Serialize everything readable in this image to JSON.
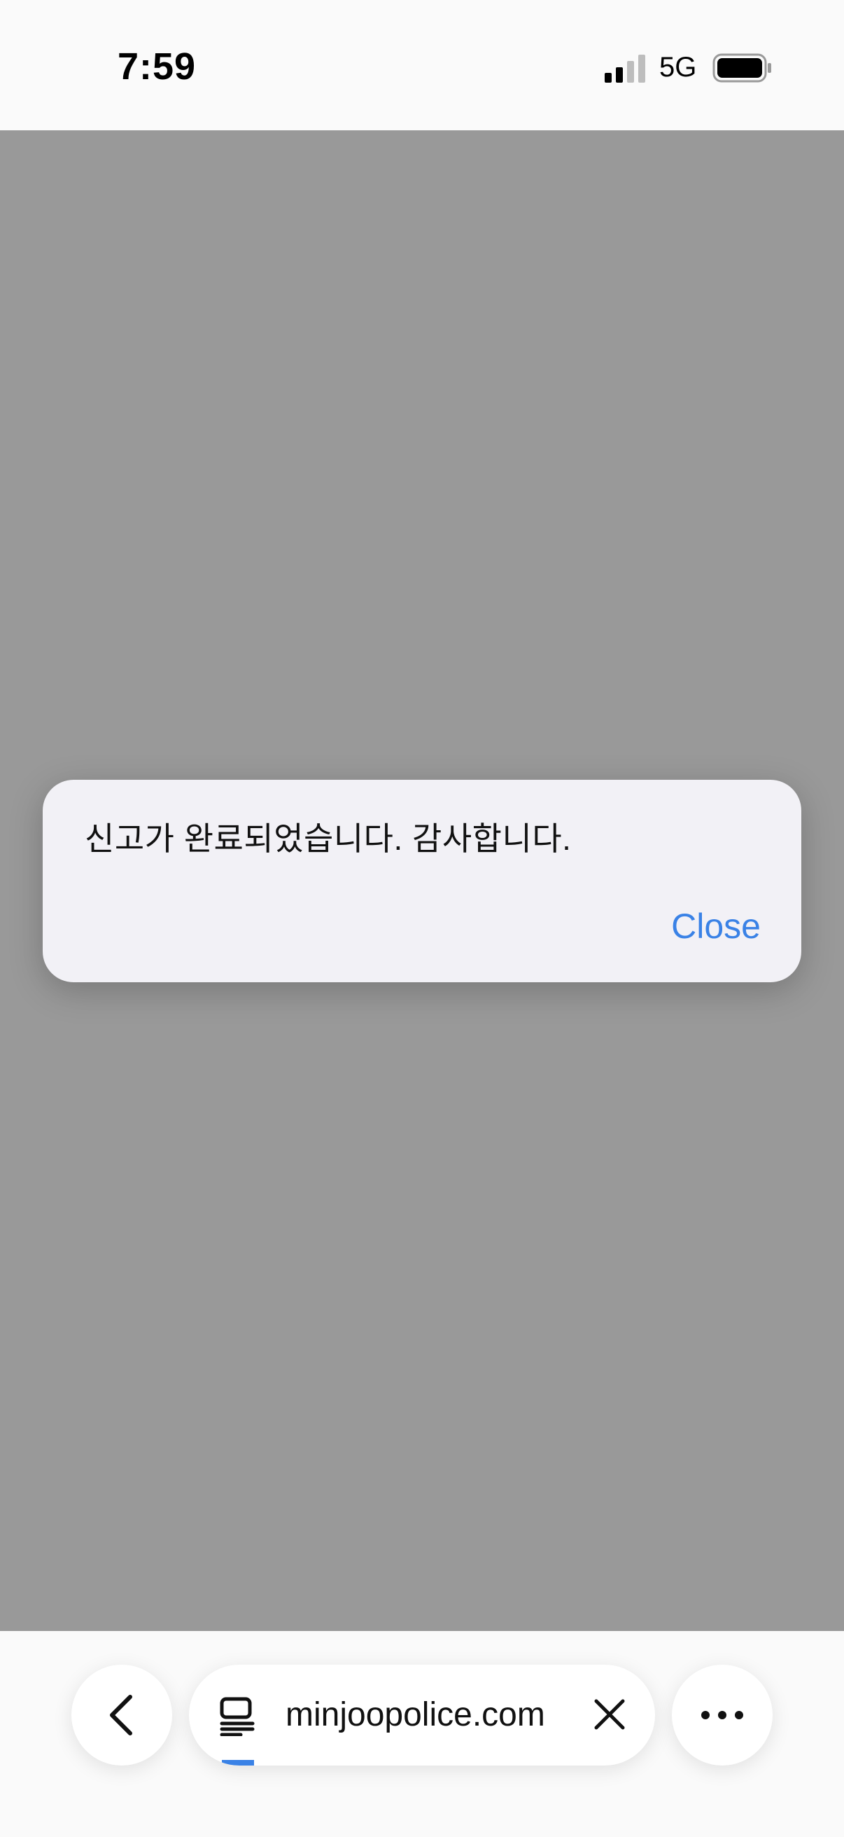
{
  "status_bar": {
    "time": "7:59",
    "network": "5G",
    "signal_icon": "cellular-signal-icon",
    "battery_icon": "battery-icon"
  },
  "alert": {
    "message": "신고가 완료되었습니다. 감사합니다.",
    "close_label": "Close",
    "accent_color": "#3a82e6"
  },
  "toolbar": {
    "back_icon": "chevron-left-icon",
    "tab_icon": "tabs-icon",
    "url": "minjoopolice.com",
    "clear_icon": "close-icon",
    "more_icon": "ellipsis-icon",
    "page_load_progress": 0.07
  },
  "colors": {
    "overlay": "#999999",
    "alert_bg": "#f2f1f6",
    "accent": "#3a82e6"
  }
}
